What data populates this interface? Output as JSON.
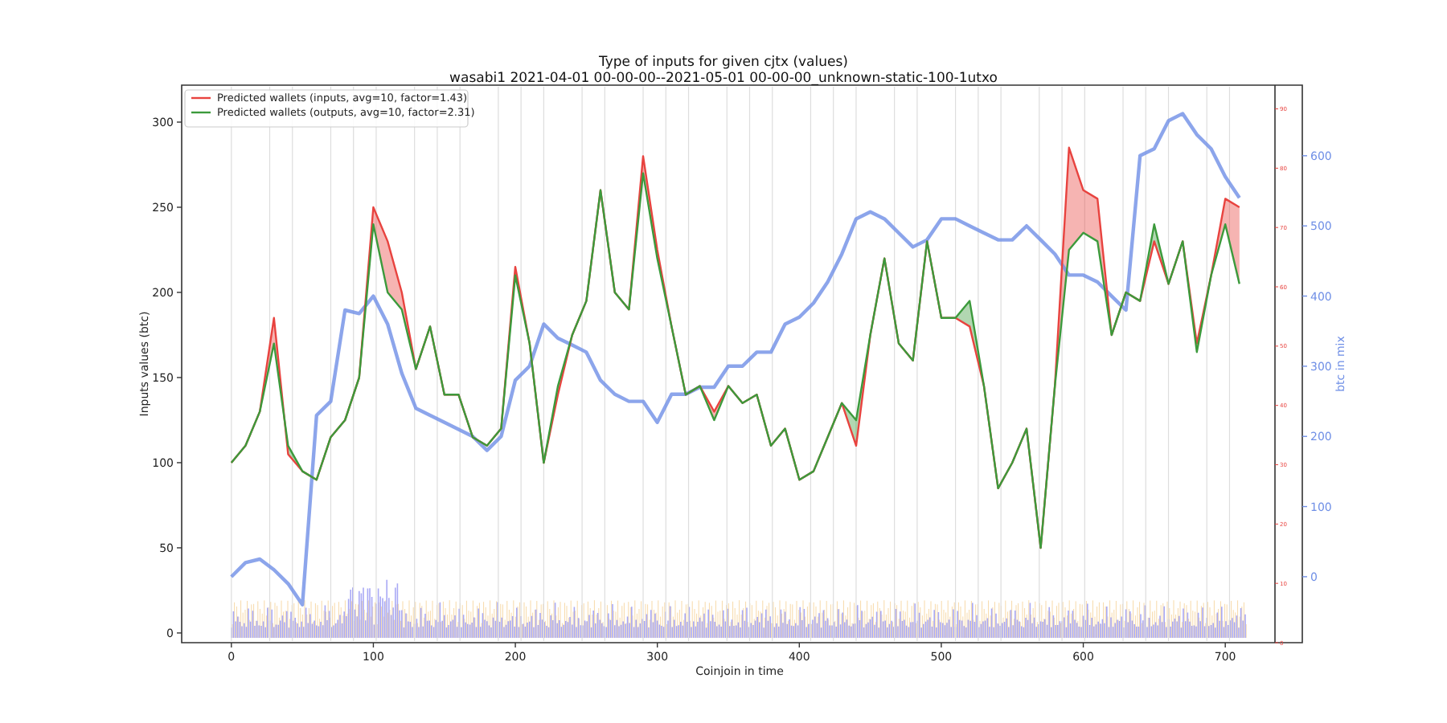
{
  "figure": {
    "chart_data": {
      "type": "line",
      "title": "Type of inputs for given cjtx (values)",
      "subtitle": "wasabi1 2021-04-01 00-00-00--2021-05-01 00-00-00_unknown-static-100-1utxo",
      "xlabel": "Coinjoin in time",
      "ylabel": "Inputs values (btc)",
      "y2label": "btc in mix",
      "x": [
        0,
        10,
        20,
        30,
        40,
        50,
        60,
        70,
        80,
        90,
        100,
        110,
        120,
        130,
        140,
        150,
        160,
        170,
        180,
        190,
        200,
        210,
        220,
        230,
        240,
        250,
        260,
        270,
        280,
        290,
        300,
        310,
        320,
        330,
        340,
        350,
        360,
        370,
        380,
        390,
        400,
        410,
        420,
        430,
        440,
        450,
        460,
        470,
        480,
        490,
        500,
        510,
        520,
        530,
        540,
        550,
        560,
        570,
        580,
        590,
        600,
        610,
        620,
        630,
        640,
        650,
        660,
        670,
        680,
        690,
        700,
        710
      ],
      "series": [
        {
          "name": "Predicted wallets (inputs, avg=10, factor=1.43)",
          "color": "#e8433f",
          "values": [
            100,
            110,
            130,
            185,
            105,
            95,
            90,
            115,
            125,
            150,
            250,
            230,
            200,
            155,
            180,
            140,
            140,
            115,
            110,
            120,
            215,
            170,
            100,
            140,
            175,
            195,
            260,
            200,
            190,
            280,
            225,
            180,
            140,
            145,
            130,
            145,
            135,
            140,
            110,
            120,
            90,
            95,
            115,
            135,
            110,
            175,
            220,
            170,
            160,
            230,
            185,
            185,
            180,
            145,
            85,
            100,
            120,
            50,
            145,
            285,
            260,
            255,
            175,
            200,
            195,
            230,
            205,
            230,
            170,
            210,
            255,
            250
          ]
        },
        {
          "name": "Predicted wallets (outputs, avg=10, factor=2.31)",
          "color": "#3c9a3c",
          "values": [
            100,
            110,
            130,
            170,
            110,
            95,
            90,
            115,
            125,
            150,
            240,
            200,
            190,
            155,
            180,
            140,
            140,
            115,
            110,
            120,
            210,
            170,
            100,
            145,
            175,
            195,
            260,
            200,
            190,
            270,
            220,
            180,
            140,
            145,
            125,
            145,
            135,
            140,
            110,
            120,
            90,
            95,
            115,
            135,
            125,
            175,
            220,
            170,
            160,
            230,
            185,
            185,
            195,
            145,
            85,
            100,
            120,
            50,
            145,
            225,
            235,
            230,
            175,
            200,
            195,
            240,
            205,
            230,
            165,
            210,
            240,
            205
          ]
        },
        {
          "color": "#6f8fe6",
          "axis": "y2",
          "values": [
            0,
            20,
            25,
            10,
            -10,
            -40,
            230,
            250,
            380,
            375,
            400,
            360,
            290,
            240,
            230,
            220,
            210,
            200,
            180,
            200,
            280,
            300,
            360,
            340,
            330,
            320,
            280,
            260,
            250,
            250,
            220,
            260,
            260,
            270,
            270,
            300,
            300,
            320,
            320,
            360,
            370,
            390,
            420,
            460,
            510,
            520,
            510,
            490,
            470,
            480,
            510,
            510,
            500,
            490,
            480,
            480,
            500,
            480,
            460,
            430,
            430,
            420,
            400,
            380,
            600,
            610,
            650,
            660,
            630,
            610,
            570,
            540
          ]
        }
      ],
      "grid": true,
      "legend": true,
      "xlim": [
        -35,
        735
      ],
      "ylim": [
        -5.7,
        321.7
      ],
      "y2lim": [
        -94,
        700.6
      ],
      "y3lim": [
        0,
        94
      ],
      "xticks": [
        0,
        100,
        200,
        300,
        400,
        500,
        600,
        700
      ],
      "yticks": [
        0,
        50,
        100,
        150,
        200,
        250,
        300
      ],
      "y2ticks": [
        0,
        100,
        200,
        300,
        400,
        500,
        600
      ],
      "y3ticks": [
        0,
        10,
        20,
        30,
        40,
        50,
        60,
        70,
        80,
        90
      ]
    }
  }
}
